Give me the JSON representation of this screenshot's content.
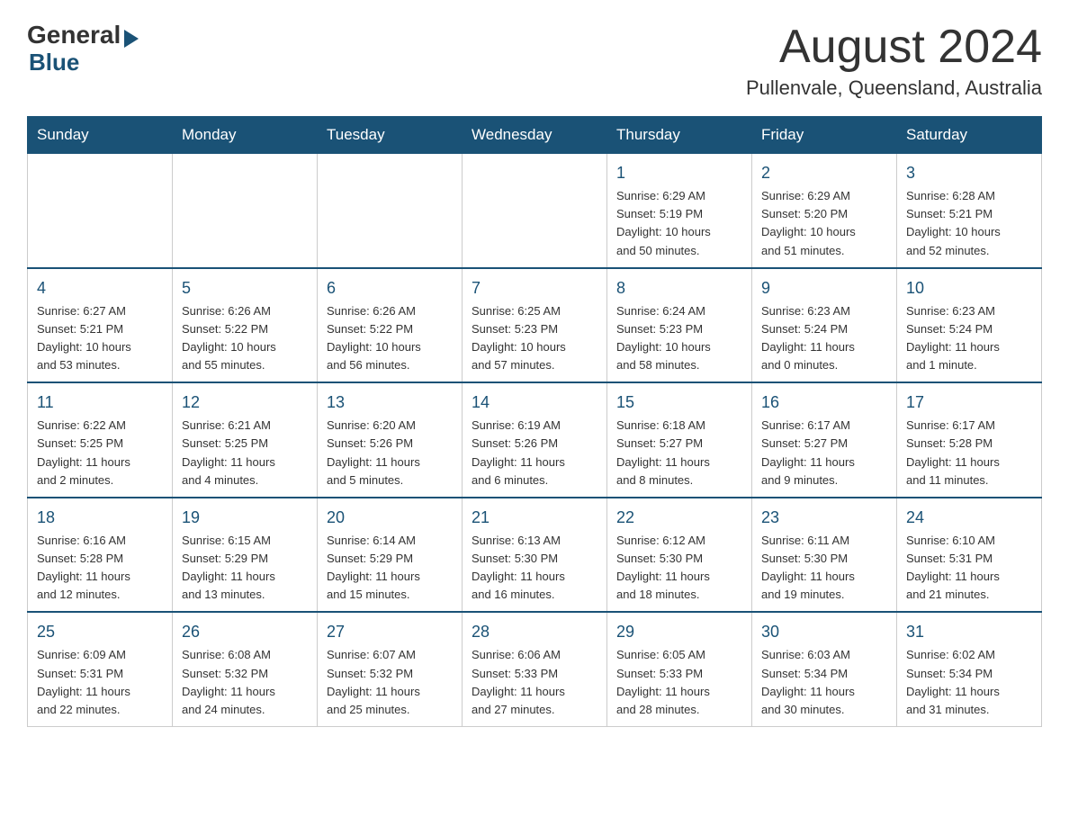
{
  "header": {
    "logo_general": "General",
    "logo_blue": "Blue",
    "month": "August 2024",
    "location": "Pullenvale, Queensland, Australia"
  },
  "days_of_week": [
    "Sunday",
    "Monday",
    "Tuesday",
    "Wednesday",
    "Thursday",
    "Friday",
    "Saturday"
  ],
  "weeks": [
    [
      {
        "day": "",
        "info": ""
      },
      {
        "day": "",
        "info": ""
      },
      {
        "day": "",
        "info": ""
      },
      {
        "day": "",
        "info": ""
      },
      {
        "day": "1",
        "info": "Sunrise: 6:29 AM\nSunset: 5:19 PM\nDaylight: 10 hours\nand 50 minutes."
      },
      {
        "day": "2",
        "info": "Sunrise: 6:29 AM\nSunset: 5:20 PM\nDaylight: 10 hours\nand 51 minutes."
      },
      {
        "day": "3",
        "info": "Sunrise: 6:28 AM\nSunset: 5:21 PM\nDaylight: 10 hours\nand 52 minutes."
      }
    ],
    [
      {
        "day": "4",
        "info": "Sunrise: 6:27 AM\nSunset: 5:21 PM\nDaylight: 10 hours\nand 53 minutes."
      },
      {
        "day": "5",
        "info": "Sunrise: 6:26 AM\nSunset: 5:22 PM\nDaylight: 10 hours\nand 55 minutes."
      },
      {
        "day": "6",
        "info": "Sunrise: 6:26 AM\nSunset: 5:22 PM\nDaylight: 10 hours\nand 56 minutes."
      },
      {
        "day": "7",
        "info": "Sunrise: 6:25 AM\nSunset: 5:23 PM\nDaylight: 10 hours\nand 57 minutes."
      },
      {
        "day": "8",
        "info": "Sunrise: 6:24 AM\nSunset: 5:23 PM\nDaylight: 10 hours\nand 58 minutes."
      },
      {
        "day": "9",
        "info": "Sunrise: 6:23 AM\nSunset: 5:24 PM\nDaylight: 11 hours\nand 0 minutes."
      },
      {
        "day": "10",
        "info": "Sunrise: 6:23 AM\nSunset: 5:24 PM\nDaylight: 11 hours\nand 1 minute."
      }
    ],
    [
      {
        "day": "11",
        "info": "Sunrise: 6:22 AM\nSunset: 5:25 PM\nDaylight: 11 hours\nand 2 minutes."
      },
      {
        "day": "12",
        "info": "Sunrise: 6:21 AM\nSunset: 5:25 PM\nDaylight: 11 hours\nand 4 minutes."
      },
      {
        "day": "13",
        "info": "Sunrise: 6:20 AM\nSunset: 5:26 PM\nDaylight: 11 hours\nand 5 minutes."
      },
      {
        "day": "14",
        "info": "Sunrise: 6:19 AM\nSunset: 5:26 PM\nDaylight: 11 hours\nand 6 minutes."
      },
      {
        "day": "15",
        "info": "Sunrise: 6:18 AM\nSunset: 5:27 PM\nDaylight: 11 hours\nand 8 minutes."
      },
      {
        "day": "16",
        "info": "Sunrise: 6:17 AM\nSunset: 5:27 PM\nDaylight: 11 hours\nand 9 minutes."
      },
      {
        "day": "17",
        "info": "Sunrise: 6:17 AM\nSunset: 5:28 PM\nDaylight: 11 hours\nand 11 minutes."
      }
    ],
    [
      {
        "day": "18",
        "info": "Sunrise: 6:16 AM\nSunset: 5:28 PM\nDaylight: 11 hours\nand 12 minutes."
      },
      {
        "day": "19",
        "info": "Sunrise: 6:15 AM\nSunset: 5:29 PM\nDaylight: 11 hours\nand 13 minutes."
      },
      {
        "day": "20",
        "info": "Sunrise: 6:14 AM\nSunset: 5:29 PM\nDaylight: 11 hours\nand 15 minutes."
      },
      {
        "day": "21",
        "info": "Sunrise: 6:13 AM\nSunset: 5:30 PM\nDaylight: 11 hours\nand 16 minutes."
      },
      {
        "day": "22",
        "info": "Sunrise: 6:12 AM\nSunset: 5:30 PM\nDaylight: 11 hours\nand 18 minutes."
      },
      {
        "day": "23",
        "info": "Sunrise: 6:11 AM\nSunset: 5:30 PM\nDaylight: 11 hours\nand 19 minutes."
      },
      {
        "day": "24",
        "info": "Sunrise: 6:10 AM\nSunset: 5:31 PM\nDaylight: 11 hours\nand 21 minutes."
      }
    ],
    [
      {
        "day": "25",
        "info": "Sunrise: 6:09 AM\nSunset: 5:31 PM\nDaylight: 11 hours\nand 22 minutes."
      },
      {
        "day": "26",
        "info": "Sunrise: 6:08 AM\nSunset: 5:32 PM\nDaylight: 11 hours\nand 24 minutes."
      },
      {
        "day": "27",
        "info": "Sunrise: 6:07 AM\nSunset: 5:32 PM\nDaylight: 11 hours\nand 25 minutes."
      },
      {
        "day": "28",
        "info": "Sunrise: 6:06 AM\nSunset: 5:33 PM\nDaylight: 11 hours\nand 27 minutes."
      },
      {
        "day": "29",
        "info": "Sunrise: 6:05 AM\nSunset: 5:33 PM\nDaylight: 11 hours\nand 28 minutes."
      },
      {
        "day": "30",
        "info": "Sunrise: 6:03 AM\nSunset: 5:34 PM\nDaylight: 11 hours\nand 30 minutes."
      },
      {
        "day": "31",
        "info": "Sunrise: 6:02 AM\nSunset: 5:34 PM\nDaylight: 11 hours\nand 31 minutes."
      }
    ]
  ]
}
